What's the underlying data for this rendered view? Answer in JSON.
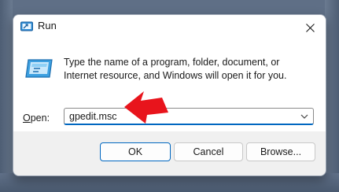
{
  "window": {
    "title": "Run",
    "icon": "run-dialog-icon",
    "close_icon": "close-icon"
  },
  "body": {
    "app_icon": "run-app-icon",
    "description": "Type the name of a program, folder, document, or Internet resource, and Windows will open it for you."
  },
  "open": {
    "label_accel": "O",
    "label_rest": "pen:",
    "value": "gpedit.msc",
    "dropdown_icon": "chevron-down-icon"
  },
  "buttons": {
    "ok": "OK",
    "cancel": "Cancel",
    "browse": "Browse..."
  },
  "annotation": {
    "icon": "red-arrow-pointer",
    "color": "#e8141c"
  },
  "colors": {
    "accent": "#0067c0",
    "dialog_bg": "#f0f0f0",
    "content_bg": "#ffffff"
  }
}
